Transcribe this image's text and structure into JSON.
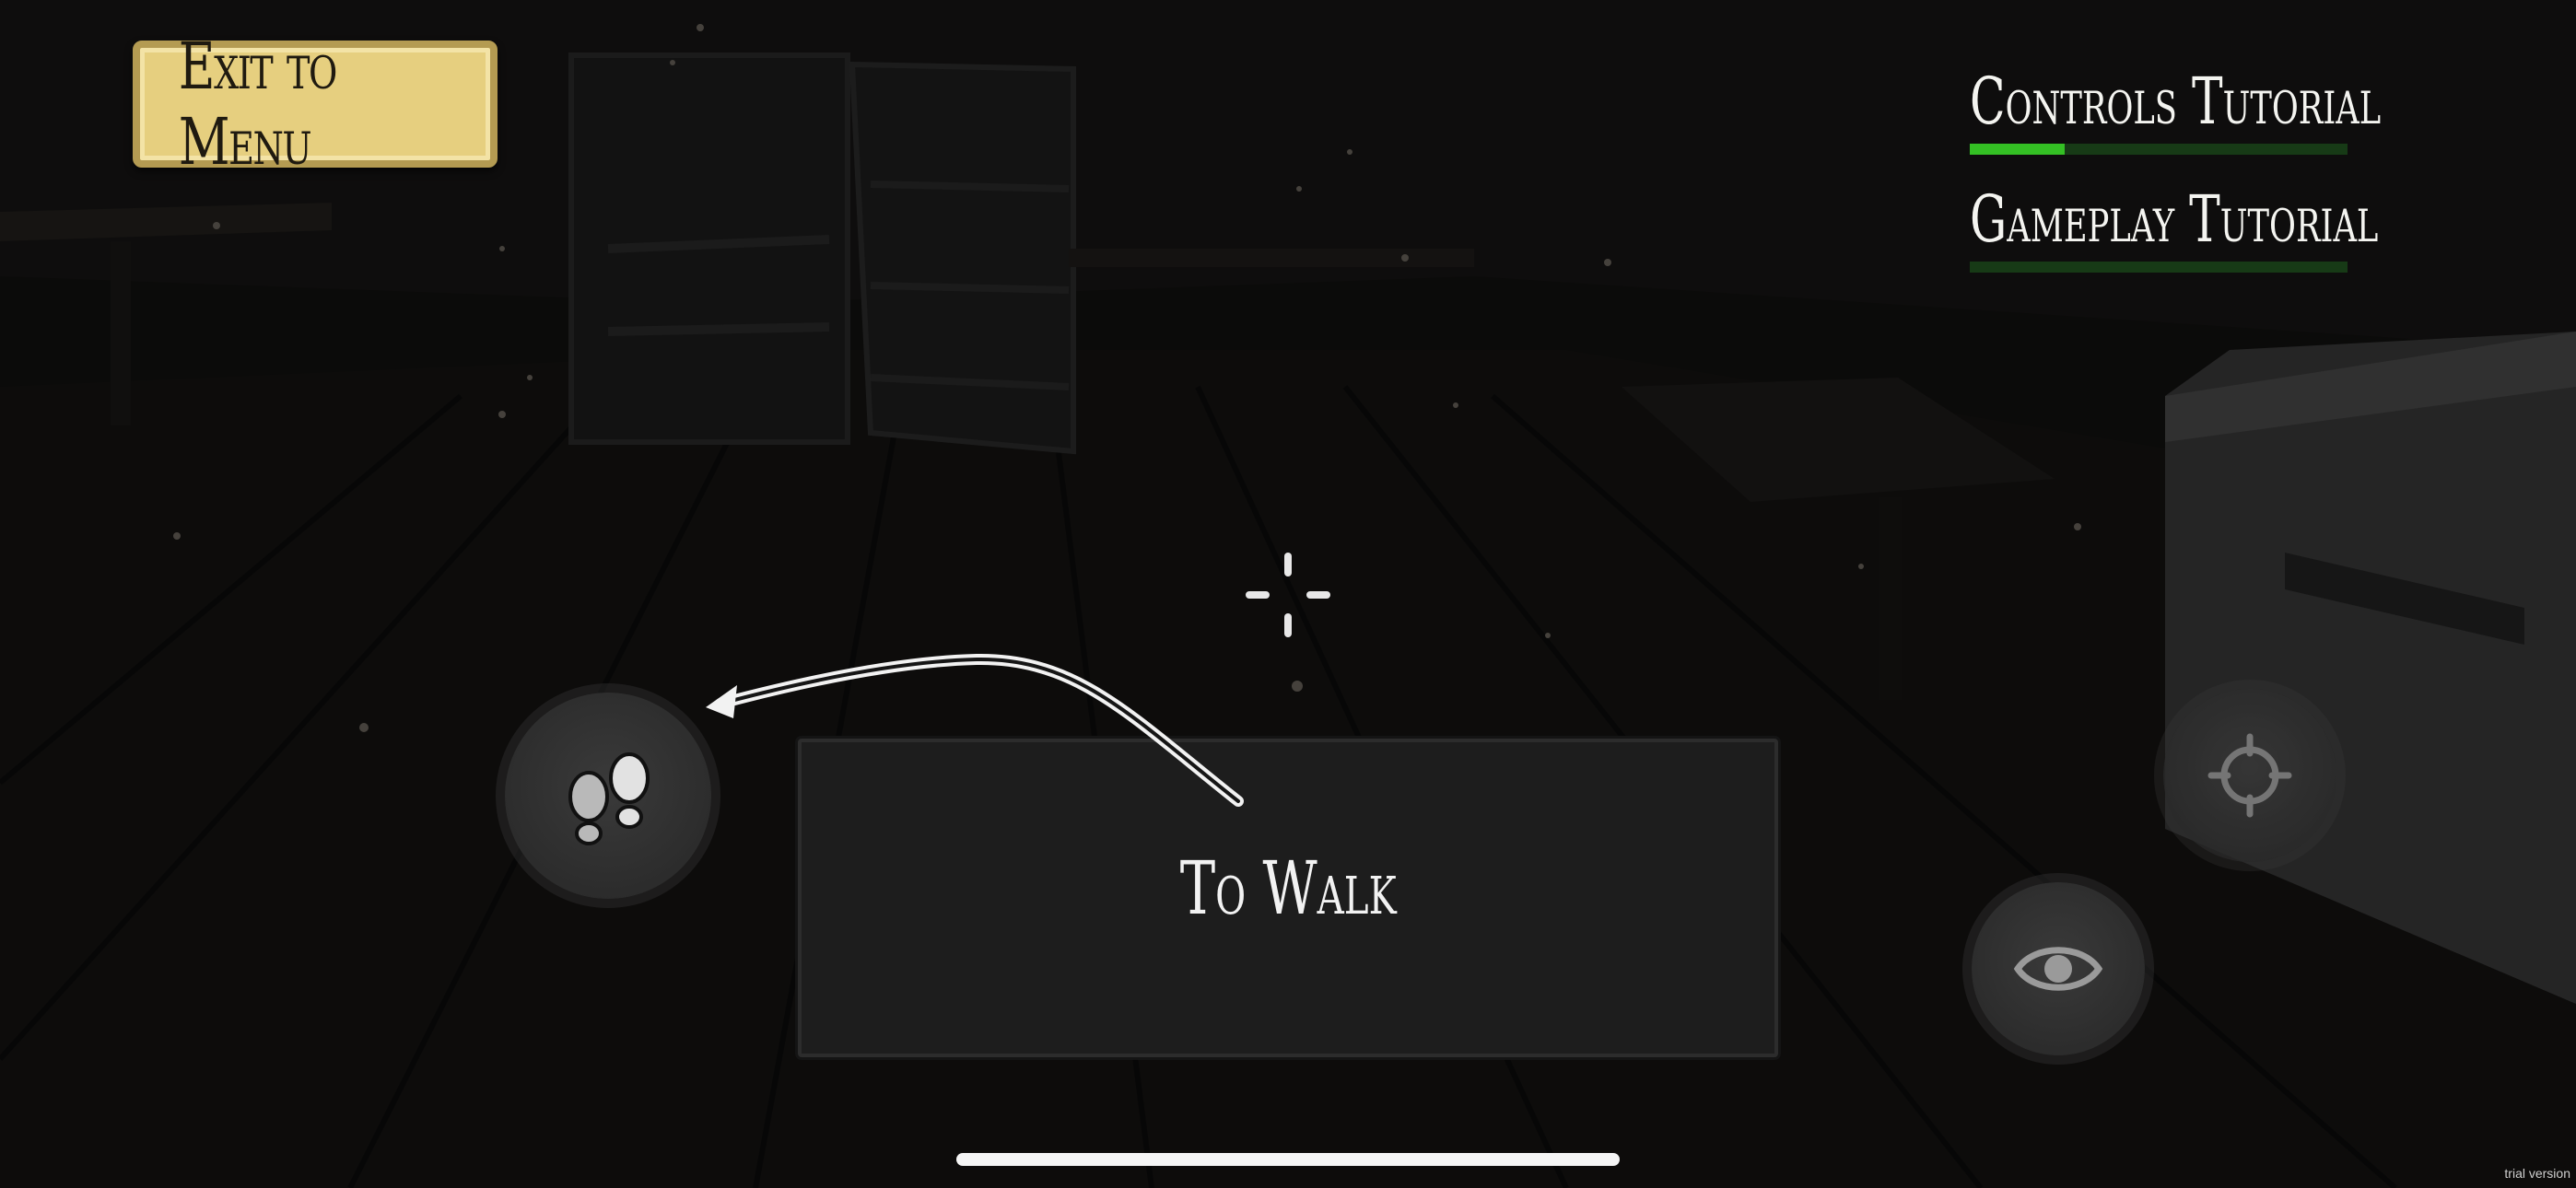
{
  "menu": {
    "exit_label": "Exit to Menu"
  },
  "tutorials": [
    {
      "label": "Controls Tutorial",
      "progress": 0.25
    },
    {
      "label": "Gameplay Tutorial",
      "progress": 0.0
    }
  ],
  "hint": {
    "text": "To Walk"
  },
  "controls": {
    "walk": "footprints-icon",
    "aim": "crosshair-target-icon",
    "look": "eye-icon"
  },
  "colors": {
    "exit_button": "#e6cf7f",
    "progress_fill": "#34c024",
    "progress_track": "#173a16"
  },
  "watermark": "trial version"
}
